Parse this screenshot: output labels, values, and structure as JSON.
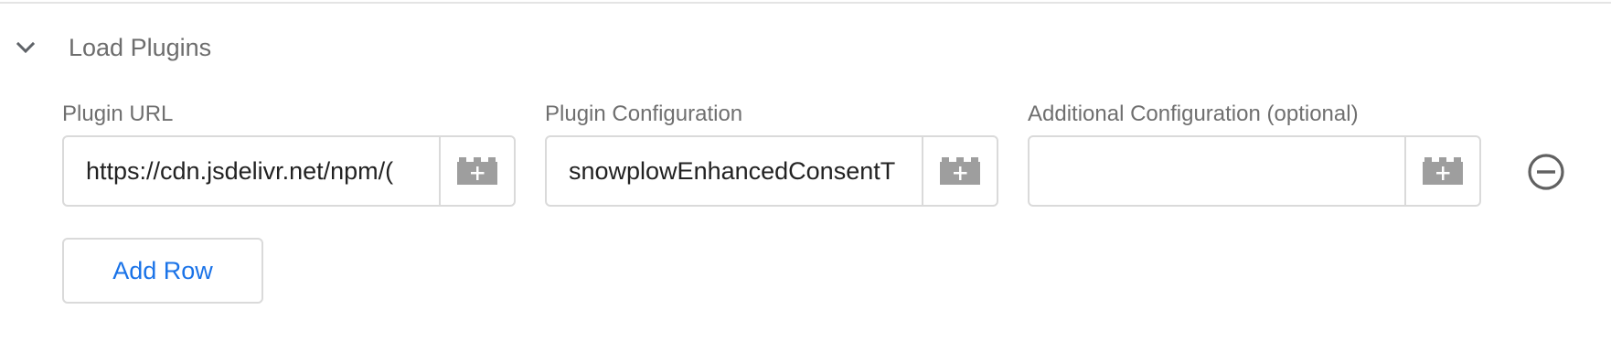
{
  "section": {
    "title": "Load Plugins",
    "expanded": true,
    "icon": "chevron-down-icon"
  },
  "columns": [
    {
      "label": "Plugin URL"
    },
    {
      "label": "Plugin Configuration"
    },
    {
      "label": "Additional Configuration (optional)"
    }
  ],
  "row": {
    "plugin_url": "https://cdn.jsdelivr.net/npm/(",
    "plugin_configuration": "snowplowEnhancedConsentT",
    "additional_configuration": ""
  },
  "icons": {
    "variable": "variable-picker-icon",
    "remove": "remove-row-icon"
  },
  "actions": {
    "add_row_label": "Add Row"
  },
  "colors": {
    "accent": "#1a73e8",
    "border": "#dadada",
    "icon": "#9e9e9e",
    "label": "#6f6f6f"
  }
}
